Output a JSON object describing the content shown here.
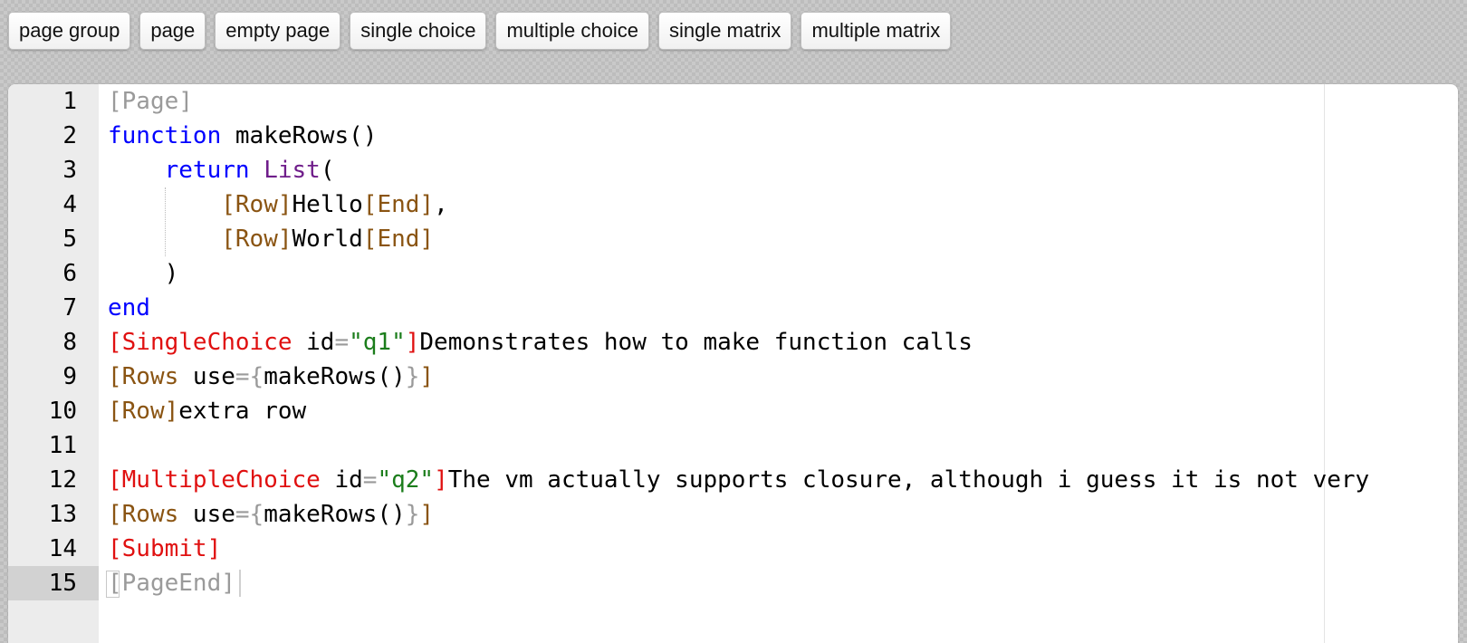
{
  "toolbar": {
    "buttons": [
      {
        "label": "page group"
      },
      {
        "label": "page"
      },
      {
        "label": "empty page"
      },
      {
        "label": "single choice"
      },
      {
        "label": "multiple choice"
      },
      {
        "label": "single matrix"
      },
      {
        "label": "multiple matrix"
      }
    ]
  },
  "editor": {
    "line_numbers": [
      "1",
      "2",
      "3",
      "4",
      "5",
      "6",
      "7",
      "8",
      "9",
      "10",
      "11",
      "12",
      "13",
      "14",
      "15"
    ],
    "active_line": 15,
    "lines": [
      [
        {
          "t": "[Page]",
          "c": "gray"
        }
      ],
      [
        {
          "t": "function",
          "c": "kw"
        },
        {
          "t": " makeRows()",
          "c": "id"
        }
      ],
      [
        {
          "t": "    ",
          "c": "id"
        },
        {
          "t": "return",
          "c": "kw"
        },
        {
          "t": " ",
          "c": "id"
        },
        {
          "t": "List",
          "c": "fn"
        },
        {
          "t": "(",
          "c": "id"
        }
      ],
      [
        {
          "t": "        ",
          "c": "id"
        },
        {
          "t": "[Row]",
          "c": "tag"
        },
        {
          "t": "Hello",
          "c": "id"
        },
        {
          "t": "[End]",
          "c": "tag"
        },
        {
          "t": ",",
          "c": "id"
        }
      ],
      [
        {
          "t": "        ",
          "c": "id"
        },
        {
          "t": "[Row]",
          "c": "tag"
        },
        {
          "t": "World",
          "c": "id"
        },
        {
          "t": "[End]",
          "c": "tag"
        }
      ],
      [
        {
          "t": "    )",
          "c": "id"
        }
      ],
      [
        {
          "t": "end",
          "c": "kw"
        }
      ],
      [
        {
          "t": "[SingleChoice",
          "c": "red"
        },
        {
          "t": " id",
          "c": "id"
        },
        {
          "t": "=",
          "c": "gray"
        },
        {
          "t": "\"q1\"",
          "c": "str"
        },
        {
          "t": "]",
          "c": "red"
        },
        {
          "t": "Demonstrates how to make function calls",
          "c": "id"
        }
      ],
      [
        {
          "t": "[Rows",
          "c": "tag"
        },
        {
          "t": " use",
          "c": "id"
        },
        {
          "t": "={",
          "c": "gray"
        },
        {
          "t": "makeRows()",
          "c": "id"
        },
        {
          "t": "}",
          "c": "gray"
        },
        {
          "t": "]",
          "c": "tag"
        }
      ],
      [
        {
          "t": "[Row]",
          "c": "tag"
        },
        {
          "t": "extra row",
          "c": "id"
        }
      ],
      [],
      [
        {
          "t": "[MultipleChoice",
          "c": "red"
        },
        {
          "t": " id",
          "c": "id"
        },
        {
          "t": "=",
          "c": "gray"
        },
        {
          "t": "\"q2\"",
          "c": "str"
        },
        {
          "t": "]",
          "c": "red"
        },
        {
          "t": "The vm actually supports closure, although i guess it is not very",
          "c": "id"
        }
      ],
      [
        {
          "t": "[Rows",
          "c": "tag"
        },
        {
          "t": " use",
          "c": "id"
        },
        {
          "t": "={",
          "c": "gray"
        },
        {
          "t": "makeRows()",
          "c": "id"
        },
        {
          "t": "}",
          "c": "gray"
        },
        {
          "t": "]",
          "c": "tag"
        }
      ],
      [
        {
          "t": "[Submit]",
          "c": "red"
        }
      ],
      [
        {
          "t": "[PageEnd]",
          "c": "gray"
        }
      ]
    ]
  },
  "colors": {
    "keyword": "#0000ff",
    "function_name": "#6f1d8a",
    "tag": "#8a5412",
    "question_tag": "#e01010",
    "page_marker": "#9a9a9a",
    "string": "#1b7d1b"
  }
}
